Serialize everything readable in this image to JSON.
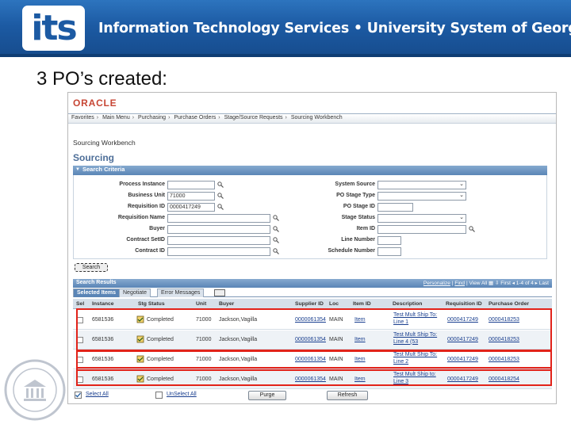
{
  "slide": {
    "logo": "its",
    "banner": "Information Technology Services • University System of Georgia",
    "heading": "3 PO’s created:"
  },
  "app": {
    "vendor_logo": "ORACLE",
    "breadcrumbs": [
      "Favorites",
      "Main Menu",
      "Purchasing",
      "Purchase Orders",
      "Stage/Source Requests",
      "Sourcing Workbench"
    ],
    "page_subtitle": "Sourcing Workbench",
    "page_title": "Sourcing"
  },
  "criteria": {
    "header": "Search Criteria",
    "labels": {
      "process_instance": "Process Instance",
      "business_unit": "Business Unit",
      "requisition_id": "Requisition ID",
      "requisition_name": "Requisition Name",
      "buyer": "Buyer",
      "contract_setid": "Contract SetID",
      "contract_id": "Contract ID",
      "system_source": "System Source",
      "po_stage_type": "PO Stage Type",
      "po_stage_id": "PO Stage ID",
      "stage_status": "Stage Status",
      "item_id": "Item ID",
      "line_number": "Line Number",
      "schedule_number": "Schedule Number"
    },
    "values": {
      "business_unit": "71000",
      "requisition_id": "0000417249"
    },
    "search_button": "Search"
  },
  "results": {
    "header": "Search Results",
    "nav": {
      "personalize": "Personalize",
      "find": "Find",
      "view_all": "View All",
      "first": "First",
      "range": "1-4 of 4",
      "last": "Last"
    },
    "tabs": [
      "Selected Items",
      "Negotiate",
      "Error Messages"
    ],
    "columns": [
      "Sel",
      "Instance",
      "Stg Status",
      "Unit",
      "Buyer",
      "Supplier ID",
      "Loc",
      "Item ID",
      "Description",
      "Requisition ID",
      "Purchase Order"
    ],
    "rows": [
      {
        "instance": "6581536",
        "status": "Completed",
        "unit": "71000",
        "buyer": "Jackson,Vagilla",
        "supplier": "0000061354",
        "loc": "MAIN",
        "item": "Item",
        "desc": "Test Mult Ship To: Line 1",
        "req": "0000417249",
        "po": "0000418253"
      },
      {
        "instance": "6581536",
        "status": "Completed",
        "unit": "71000",
        "buyer": "Jackson,Vagilla",
        "supplier": "0000061354",
        "loc": "MAIN",
        "item": "Item",
        "desc": "Test Mult Ship To: Line 4 (53",
        "req": "0000417249",
        "po": "0000418253"
      },
      {
        "instance": "6581536",
        "status": "Completed",
        "unit": "71000",
        "buyer": "Jackson,Vagilla",
        "supplier": "0000061354",
        "loc": "MAIN",
        "item": "Item",
        "desc": "Test Mult Ship To: Line 2",
        "req": "0000417249",
        "po": "0000418253"
      },
      {
        "instance": "6581536",
        "status": "Completed",
        "unit": "71000",
        "buyer": "Jackson,Vagilla",
        "supplier": "0000061354",
        "loc": "MAIN",
        "item": "Item",
        "desc": "Test Mult Ship to: Line 3",
        "req": "0000417249",
        "po": "0000418254"
      }
    ],
    "select_all": "Select All",
    "unselect_all": "UnSelect All",
    "purge_button": "Purge",
    "refresh_button": "Refresh"
  },
  "colors": {
    "banner": "#1c5aa3",
    "highlight": "#e2231a",
    "panel_header": "#5a85b6",
    "oracle_red": "#c74634"
  }
}
